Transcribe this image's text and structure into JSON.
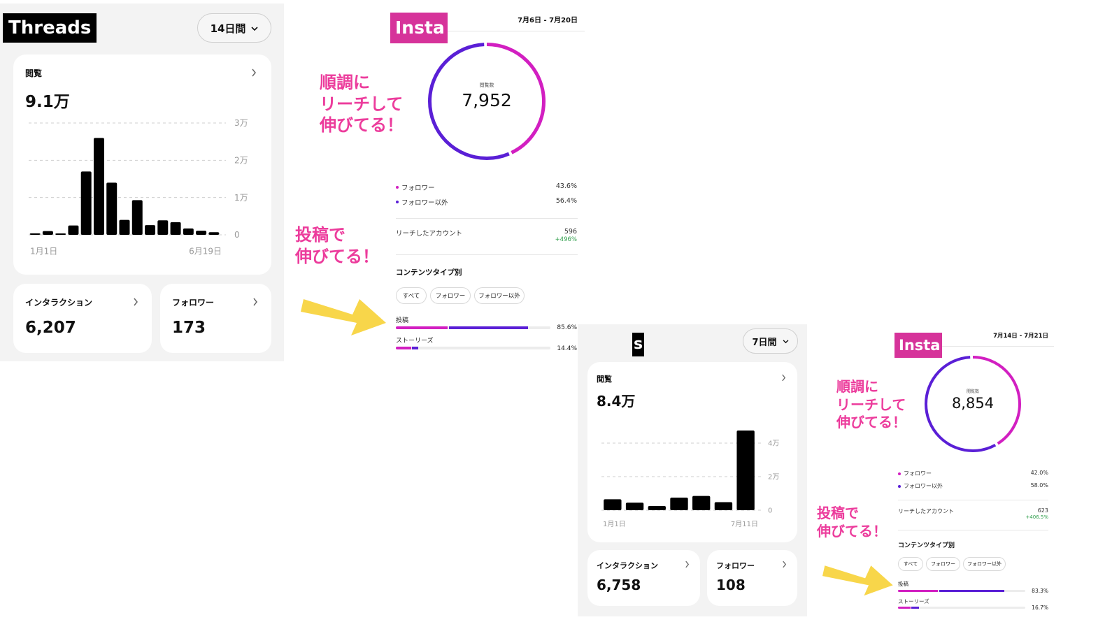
{
  "threads_top": {
    "label": "Threads",
    "range": "14日間",
    "views_title": "閲覧",
    "views_value": "9.1万",
    "y_ticks": [
      "3万",
      "2万",
      "1万",
      "0"
    ],
    "x_start": "1月1日",
    "x_end": "6月19日",
    "interaction_title": "インタラクション",
    "interaction_value": "6,207",
    "follower_title": "フォロワー",
    "follower_value": "173"
  },
  "threads_bottom": {
    "label": "s",
    "range": "7日間",
    "views_title": "閲覧",
    "views_value": "8.4万",
    "y_ticks": [
      "4万",
      "2万",
      "0"
    ],
    "x_start": "1月1日",
    "x_end": "7月11日",
    "interaction_title": "インタラクション",
    "interaction_value": "6,758",
    "follower_title": "フォロワー",
    "follower_value": "108"
  },
  "insta_top": {
    "label": "Insta",
    "date_range": "7月6日 - 7月20日",
    "ring_caption": "閲覧数",
    "ring_value": "7,952",
    "follower_label": "フォロワー",
    "follower_pct": "43.6%",
    "nonfollower_label": "フォロワー以外",
    "nonfollower_pct": "56.4%",
    "reach_label": "リーチしたアカウント",
    "reach_value": "596",
    "reach_delta": "+496%",
    "content_title": "コンテンツタイプ別",
    "chips": [
      "すべて",
      "フォロワー",
      "フォロワー以外"
    ],
    "post_label": "投稿",
    "post_pct": "85.6%",
    "story_label": "ストーリーズ",
    "story_pct": "14.4%"
  },
  "insta_bottom": {
    "label": "Insta",
    "date_range": "7月14日 - 7月21日",
    "ring_caption": "閲覧数",
    "ring_value": "8,854",
    "follower_label": "フォロワー",
    "follower_pct": "42.0%",
    "nonfollower_label": "フォロワー以外",
    "nonfollower_pct": "58.0%",
    "reach_label": "リーチしたアカウント",
    "reach_value": "623",
    "reach_delta": "+406.5%",
    "content_title": "コンテンツタイプ別",
    "chips": [
      "すべて",
      "フォロワー",
      "フォロワー以外"
    ],
    "post_label": "投稿",
    "post_pct": "83.3%",
    "story_label": "ストーリーズ",
    "story_pct": "16.7%"
  },
  "notes": {
    "reach_top": [
      "順調に",
      "リーチして",
      "伸びてる！"
    ],
    "post_top": [
      "投稿で",
      "伸びてる！"
    ],
    "reach_bottom": [
      "順調に",
      "リーチして",
      "伸びてる！"
    ],
    "post_bottom": [
      "投稿で",
      "伸びてる！"
    ]
  },
  "colors": {
    "ring_follower": "#d21fc1",
    "ring_nonfollower": "#5a1fd6",
    "insta_tag": "#d6339a",
    "note_pink": "#ec3c9c",
    "arrow_yellow": "#f8d64a"
  },
  "chart_data": [
    {
      "type": "bar",
      "xlabel": "",
      "ylabel": "",
      "x_start": "1月1日",
      "x_end": "6月19日",
      "ylim": [
        0,
        30000
      ],
      "y_ticks": [
        "3万",
        "2万",
        "1万",
        "0"
      ],
      "values": [
        400,
        1000,
        300,
        2500,
        17000,
        26000,
        14000,
        4000,
        9300,
        2600,
        3900,
        3400,
        1700,
        1100,
        700
      ]
    },
    {
      "type": "bar",
      "xlabel": "",
      "ylabel": "",
      "x_start": "1月1日",
      "x_end": "7月11日",
      "ylim": [
        0,
        40000
      ],
      "y_ticks": [
        "4万",
        "2万",
        "0"
      ],
      "values": [
        6500,
        4500,
        2500,
        7500,
        8500,
        4800,
        48000
      ]
    }
  ]
}
